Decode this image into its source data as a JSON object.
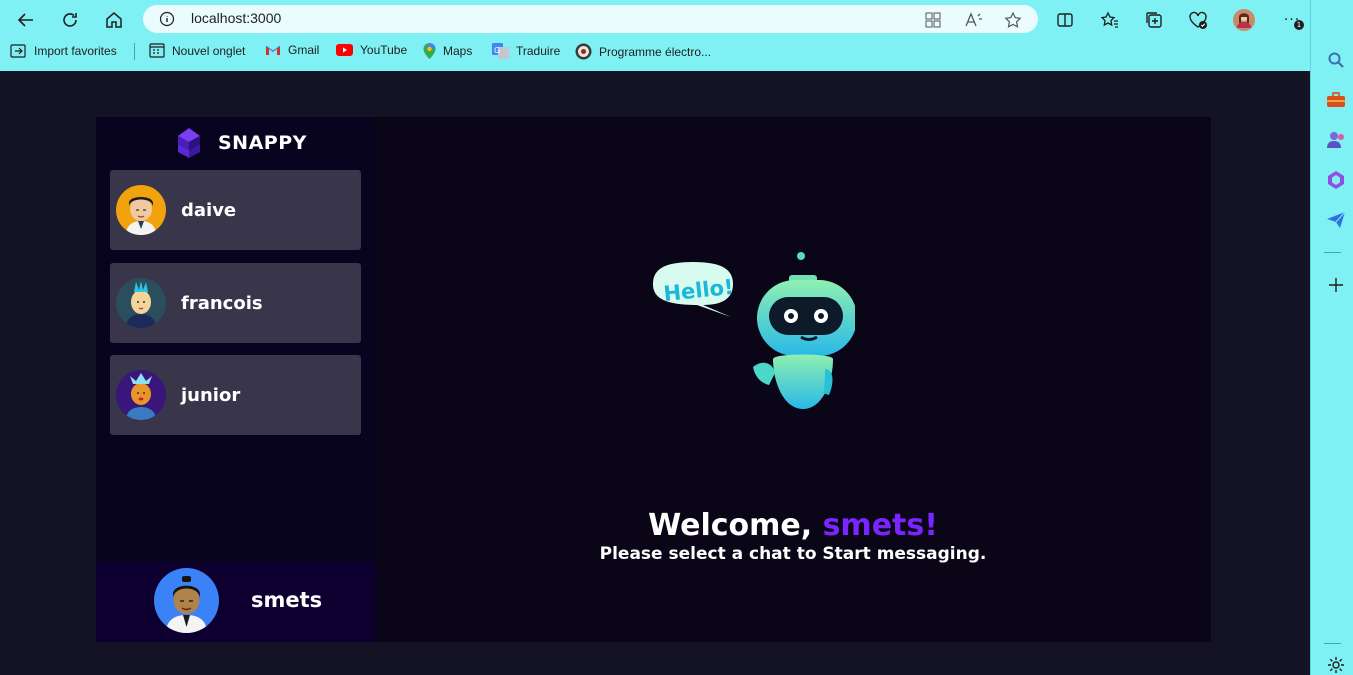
{
  "browser": {
    "url": "localhost:3000",
    "bookmarks": [
      {
        "label": "Import favorites",
        "icon": "import-icon"
      },
      {
        "label": "Nouvel onglet",
        "icon": "new-tab-icon"
      },
      {
        "label": "Gmail",
        "icon": "gmail-icon"
      },
      {
        "label": "YouTube",
        "icon": "youtube-icon"
      },
      {
        "label": "Maps",
        "icon": "maps-icon"
      },
      {
        "label": "Traduire",
        "icon": "translate-icon"
      },
      {
        "label": "Programme électro...",
        "icon": "seal-icon"
      }
    ],
    "notification_count": "1"
  },
  "app": {
    "brand": "SNAPPY",
    "contacts": [
      {
        "name": "daive"
      },
      {
        "name": "francois"
      },
      {
        "name": "junior"
      }
    ],
    "current_user": {
      "name": "smets"
    },
    "welcome": {
      "prefix": "Welcome, ",
      "username": "smets!",
      "subtitle": "Please select a chat to Start messaging.",
      "bubble_text": "Hello!"
    },
    "colors": {
      "accent": "#7a24ff",
      "sidebar_bg": "#080420",
      "contact_bg": "#3d3650"
    }
  }
}
